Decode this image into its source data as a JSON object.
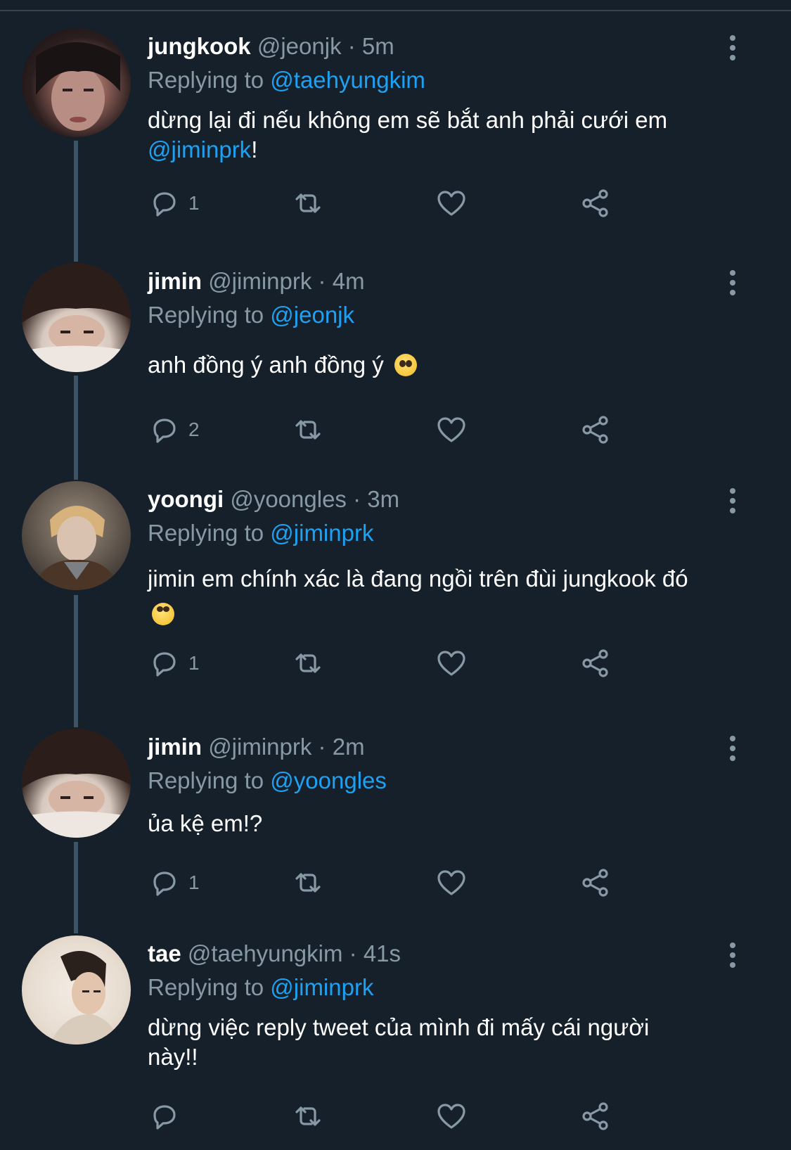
{
  "colors": {
    "background": "#15202b",
    "secondary_text": "#8899a6",
    "accent": "#1da1f2",
    "thread_line": "#3d5466"
  },
  "tweets": [
    {
      "name": "jungkook",
      "handle": "@jeonjk",
      "separator": "·",
      "time": "5m",
      "replying_label": "Replying to",
      "replying_to": "@taehyungkim",
      "text_before": "dừng lại đi nếu không em sẽ bắt anh phải cưới em ",
      "text_mention": "@jiminprk",
      "text_after": "!",
      "reply_count": "1",
      "avatar_icon": "avatar-photo"
    },
    {
      "name": "jimin",
      "handle": "@jiminprk",
      "separator": "·",
      "time": "4m",
      "replying_label": "Replying to",
      "replying_to": "@jeonjk",
      "text": "anh đồng ý anh đồng ý",
      "emoji": "pleading-face-emoji",
      "reply_count": "2",
      "avatar_icon": "avatar-photo"
    },
    {
      "name": "yoongi",
      "handle": "@yoongles",
      "separator": "·",
      "time": "3m",
      "replying_label": "Replying to",
      "replying_to": "@jiminprk",
      "text": "jimin em chính xác là đang ngồi trên đùi jungkook đó",
      "emoji": "eye-roll-emoji",
      "reply_count": "1",
      "avatar_icon": "avatar-photo"
    },
    {
      "name": "jimin",
      "handle": "@jiminprk",
      "separator": "·",
      "time": "2m",
      "replying_label": "Replying to",
      "replying_to": "@yoongles",
      "text": "ủa kệ em!?",
      "reply_count": "1",
      "avatar_icon": "avatar-photo"
    },
    {
      "name": "tae",
      "handle": "@taehyungkim",
      "separator": "·",
      "time": "41s",
      "replying_label": "Replying to",
      "replying_to": "@jiminprk",
      "text": "dừng việc reply tweet của mình đi mấy cái người này!!",
      "reply_count": "",
      "avatar_icon": "avatar-photo"
    }
  ],
  "icons": [
    "reply-icon",
    "retweet-icon",
    "like-icon",
    "share-icon",
    "more-options-icon"
  ]
}
